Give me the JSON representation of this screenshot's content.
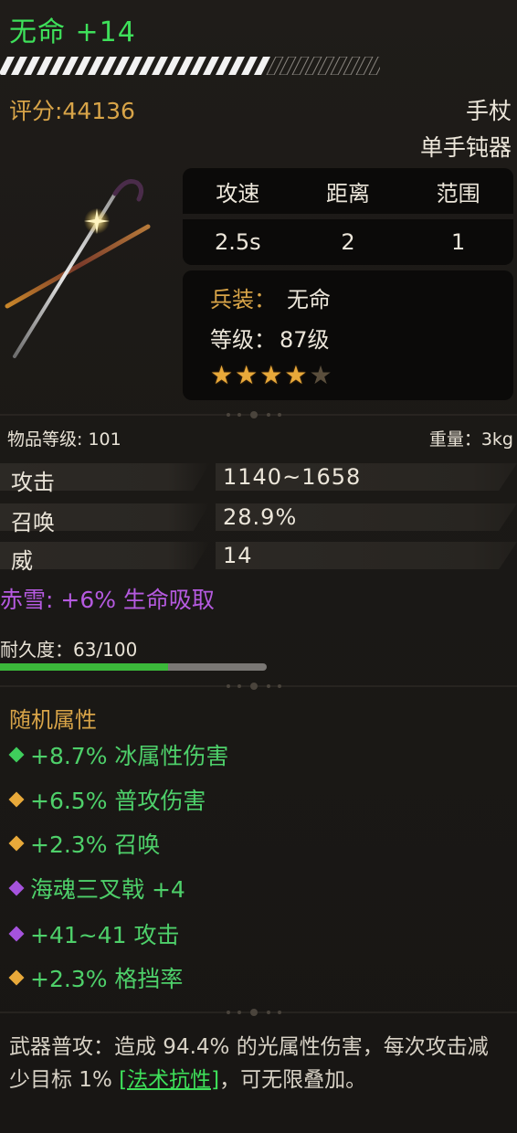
{
  "item": {
    "title": "无命 +14",
    "score": "评分:44136",
    "type1": "手杖",
    "type2": "单手钝器"
  },
  "stats": {
    "headers": [
      "攻速",
      "距离",
      "范围"
    ],
    "values": [
      "2.5s",
      "2",
      "1"
    ]
  },
  "info": {
    "weapon_label": "兵装：",
    "weapon_value": "无命",
    "level_label": "等级：",
    "level_value": "87级",
    "stars_total": 5,
    "stars_filled": 4
  },
  "meta": {
    "item_level": "物品等级: 101",
    "weight": "重量：3kg"
  },
  "attributes": [
    {
      "name": "攻击",
      "value": "1140~1658"
    },
    {
      "name": "召唤",
      "value": "28.9%"
    },
    {
      "name": "威",
      "value": "14"
    }
  ],
  "special": "赤雪: +6% 生命吸取",
  "durability": {
    "label": "耐久度：63/100",
    "fraction": 0.63
  },
  "random": {
    "title": "随机属性",
    "items": [
      {
        "text": "+8.7% 冰属性伤害",
        "gem_color": "#3fce5c"
      },
      {
        "text": "+6.5% 普攻伤害",
        "gem_color": "#e8a93a"
      },
      {
        "text": "+2.3% 召唤",
        "gem_color": "#e8a93a"
      },
      {
        "text": "海魂三叉戟 +4",
        "gem_color": "#a553dd"
      },
      {
        "text": "+41~41 攻击",
        "gem_color": "#a553dd"
      },
      {
        "text": "+2.3% 格挡率",
        "gem_color": "#e8a93a"
      }
    ]
  },
  "description": {
    "before": "武器普攻：造成 94.4% 的光属性伤害，每次攻击减少目标 1% ",
    "link": "[法术抗性]",
    "after": "，可无限叠加。"
  },
  "colors": {
    "title_green": "#3ee05a",
    "gold": "#d8a448",
    "purple": "#b55ae0",
    "durability_green": "#3bb83a"
  }
}
